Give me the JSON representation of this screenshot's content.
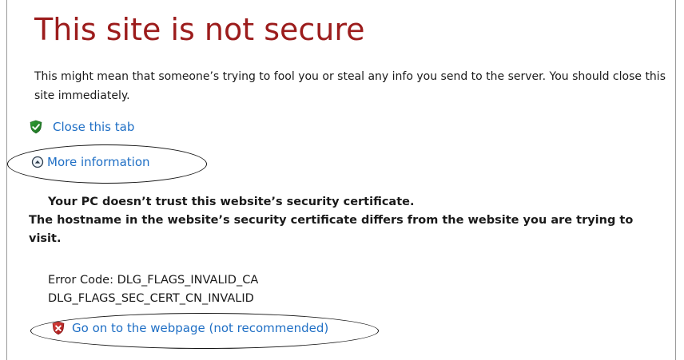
{
  "page": {
    "title": "This site is not secure",
    "description": "This might mean that someone’s trying to fool you or steal any info you send to the server. You should close this site immediately.",
    "close_tab_label": "Close this tab",
    "more_info_label": "More information",
    "details": {
      "line1": "Your PC doesn’t trust this website’s security certificate.",
      "line2": "The hostname in the website’s security certificate differs from the website you are trying to visit."
    },
    "error_code_line": "Error Code: DLG_FLAGS_INVALID_CA",
    "error_code_line2": "DLG_FLAGS_SEC_CERT_CN_INVALID",
    "go_on_label": "Go on to the webpage (not recommended)"
  },
  "icons": {
    "close_tab": "shield-check-icon",
    "more_info": "chevron-up-circle-icon",
    "go_on": "shield-x-icon"
  },
  "colors": {
    "title": "#9c1c1c",
    "link": "#1f6fc5",
    "annotation": "#111111"
  }
}
